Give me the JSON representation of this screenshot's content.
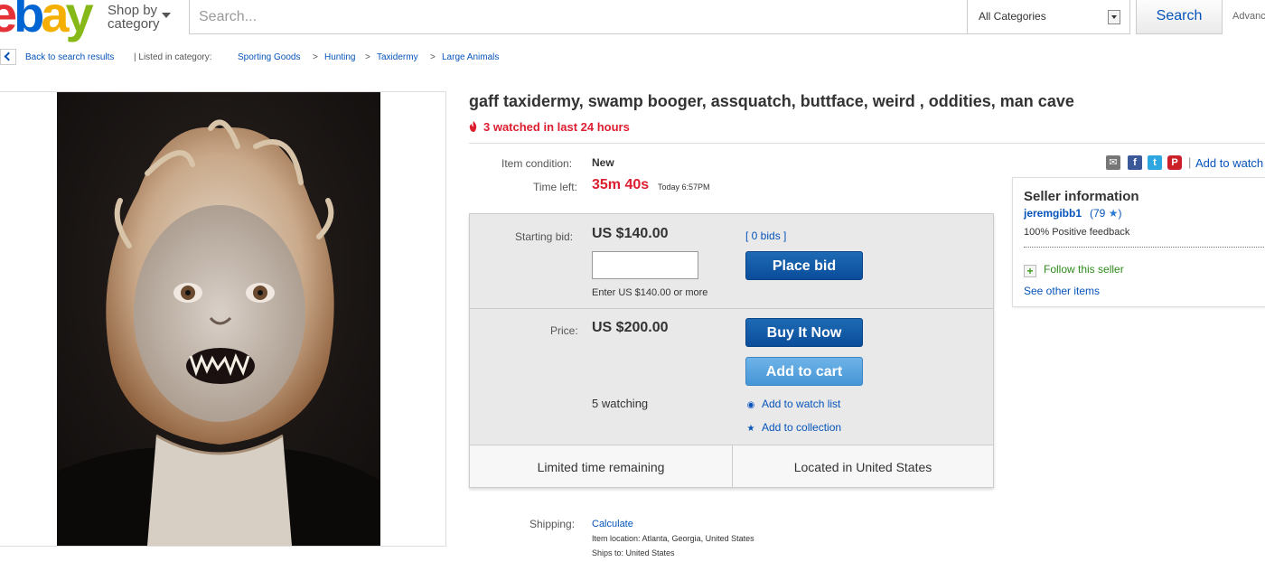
{
  "header": {
    "logo": {
      "e": "e",
      "b": "b",
      "a": "a",
      "y": "y"
    },
    "shop_by_line1": "Shop by",
    "shop_by_line2": "category",
    "search_placeholder": "Search...",
    "category_value": "All Categories",
    "search_button": "Search",
    "advanced": "Advanced"
  },
  "breadcrumb": {
    "back": "Back to search results",
    "listed": "| Listed in category:",
    "items": [
      "Sporting Goods",
      "Hunting",
      "Taxidermy",
      "Large Animals"
    ],
    "separator": ">"
  },
  "listing": {
    "title": "gaff taxidermy, swamp booger, assquatch, buttface, weird , oddities, man cave",
    "watched": "3 watched in last 24 hours",
    "condition_label": "Item condition:",
    "condition_value": "New",
    "time_label": "Time left:",
    "time_value": "35m 40s",
    "time_today": "Today 6:57PM"
  },
  "share": {
    "mail_icon": "mail-icon",
    "facebook": "f",
    "twitter": "t",
    "pinterest": "P",
    "bar": "|",
    "add_to_watch": "Add to watch list"
  },
  "bid": {
    "starting_label": "Starting bid:",
    "starting_value": "US $140.00",
    "bids_link": "[ 0 bids ]",
    "input_value": "",
    "hint": "Enter US $140.00 or more",
    "place_bid": "Place bid",
    "price_label": "Price:",
    "price_value": "US $200.00",
    "buy_now": "Buy It Now",
    "add_to_cart": "Add to cart",
    "watching": "5 watching",
    "add_watch": "Add to watch list",
    "add_collection": "Add to collection",
    "limited": "Limited time remaining",
    "located": "Located in United States"
  },
  "seller": {
    "heading": "Seller information",
    "name": "jeremgibb1",
    "score": "(79",
    "score_end": ")",
    "feedback": "100% Positive feedback",
    "follow": "Follow this seller",
    "other": "See other items"
  },
  "shipping": {
    "label": "Shipping:",
    "calculate": "Calculate",
    "location": "Item location:  Atlanta, Georgia, United States",
    "ships_to": "Ships to:  United States"
  },
  "colors": {
    "brand_blue": "#0654ba",
    "alert_red": "#dd1e31",
    "button_dark": "#0a4d9a",
    "button_light": "#4596d6"
  }
}
